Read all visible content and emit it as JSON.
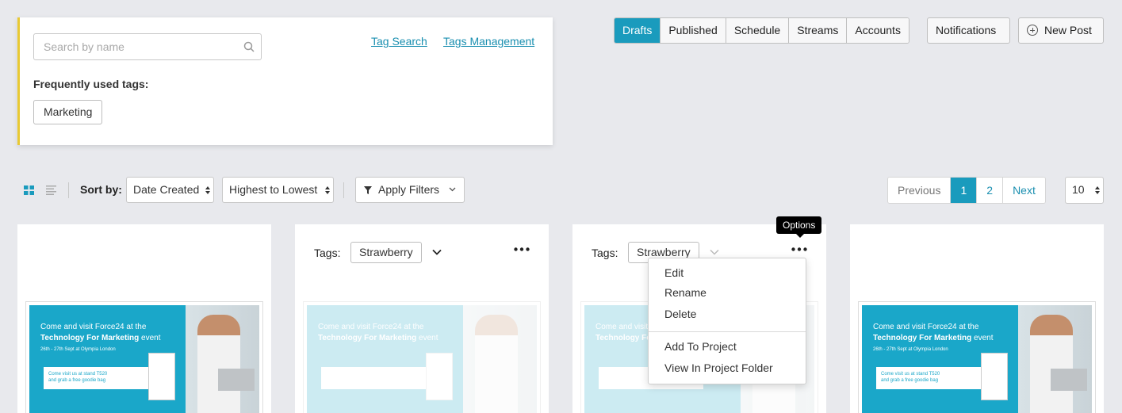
{
  "tag_panel": {
    "search_placeholder": "Search by name",
    "tag_search_link": "Tag Search",
    "tags_management_link": "Tags Management",
    "frequent_label": "Frequently used tags:",
    "frequent_tags": [
      "Marketing"
    ],
    "accent_color": "#e8c934"
  },
  "tabs": [
    {
      "label": "Drafts",
      "active": true
    },
    {
      "label": "Published",
      "active": false
    },
    {
      "label": "Schedule",
      "active": false
    },
    {
      "label": "Streams",
      "active": false
    },
    {
      "label": "Accounts",
      "active": false
    }
  ],
  "notifications_label": "Notifications",
  "new_post_label": "New Post",
  "toolbar": {
    "sort_label": "Sort by:",
    "sort_field": "Date Created",
    "sort_order": "Highest to Lowest",
    "filter_label": "Apply Filters"
  },
  "pagination": {
    "previous": "Previous",
    "pages": [
      "1",
      "2"
    ],
    "current": "1",
    "next": "Next",
    "per_page": "10"
  },
  "cards": [
    {
      "tags_label": "",
      "tag": "",
      "faded": false
    },
    {
      "tags_label": "Tags:",
      "tag": "Strawberry",
      "faded": true
    },
    {
      "tags_label": "Tags:",
      "tag": "Strawberry",
      "faded": true
    },
    {
      "tags_label": "",
      "tag": "",
      "faded": false
    }
  ],
  "thumbnail": {
    "line1": "Come and visit Force24 at the",
    "line2_bold": "Technology For Marketing",
    "line2_rest": " event",
    "line3": "26th - 27th Sept at Olympia London",
    "box_line1": "Come visit us at stand T520",
    "box_line2": "and grab a free goodie bag"
  },
  "tooltip": "Options",
  "options_menu": {
    "items_top": [
      "Edit",
      "Rename",
      "Delete"
    ],
    "items_bottom": [
      "Add To Project",
      "View In Project Folder"
    ]
  },
  "colors": {
    "primary": "#1a9bbd",
    "link": "#1a8fb0",
    "background": "#e8e9ed"
  }
}
